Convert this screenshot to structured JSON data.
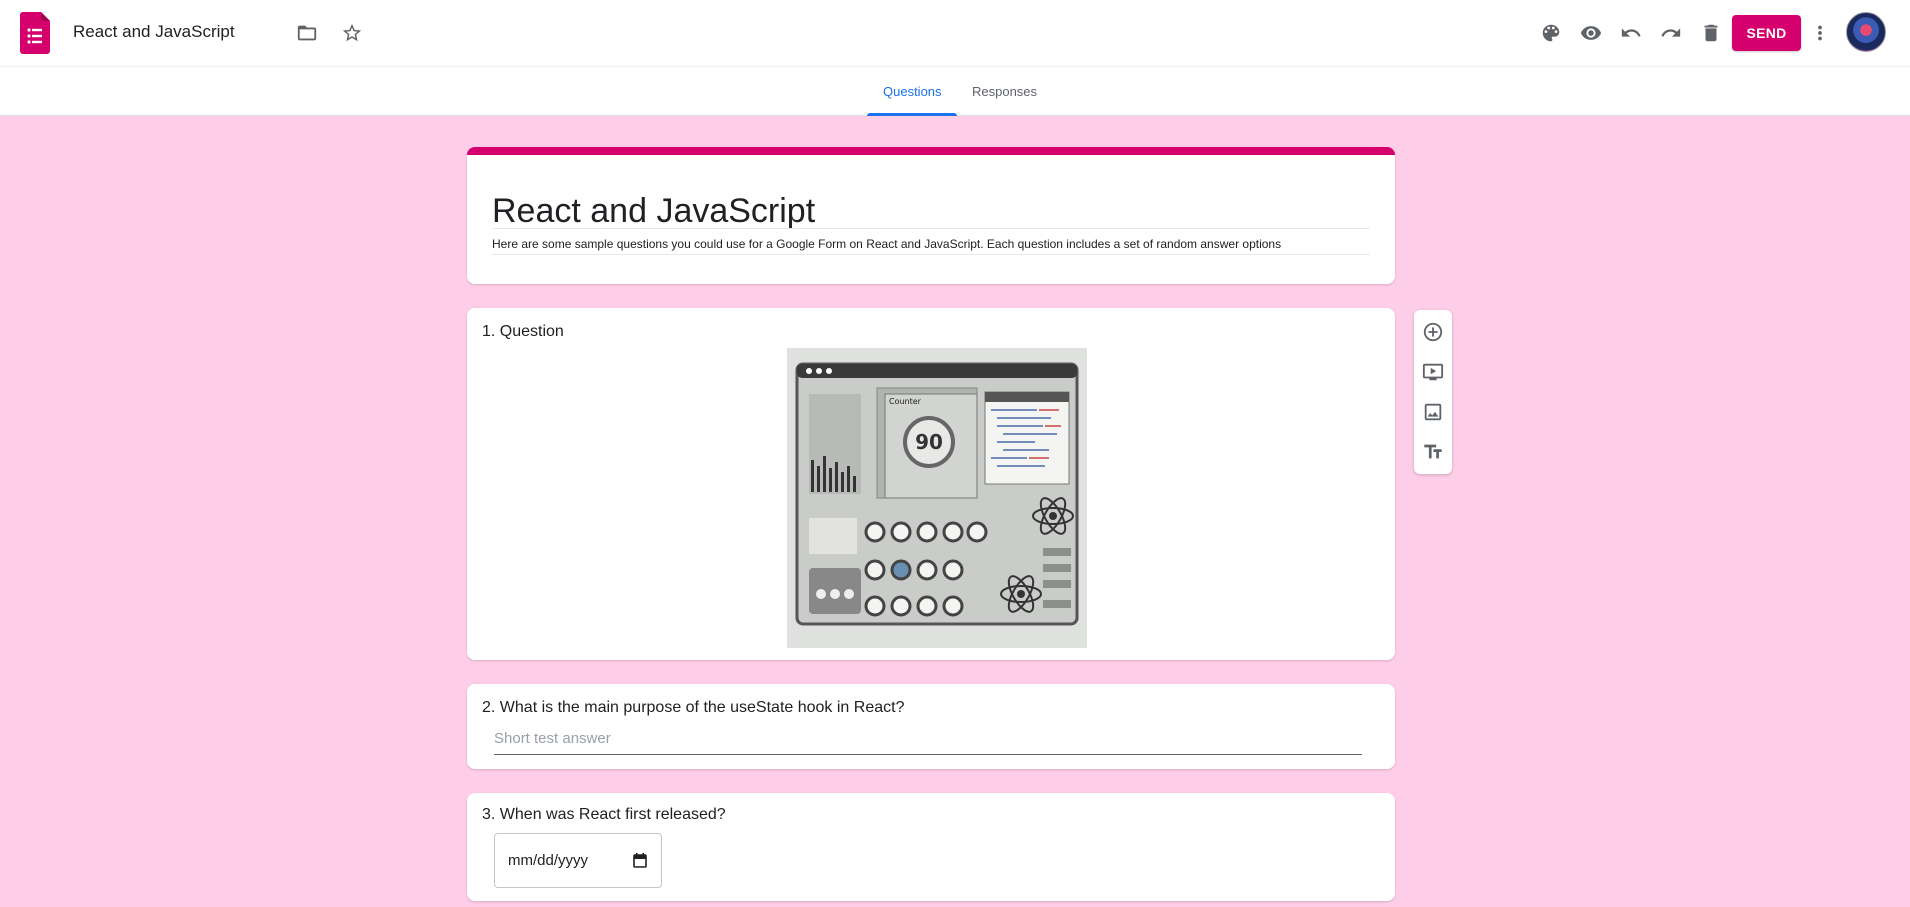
{
  "header": {
    "title": "React and JavaScript",
    "send_label": "SEND"
  },
  "tabs": [
    {
      "label": "Questions",
      "active": true
    },
    {
      "label": "Responses",
      "active": false
    }
  ],
  "form": {
    "title": "React and JavaScript",
    "description": "Here are some sample questions you could use for a Google Form on React and JavaScript. Each question includes a set of random answer options"
  },
  "questions": [
    {
      "title": "1. Question",
      "image": {
        "counter_value": "90",
        "panel_label": "Counter"
      }
    },
    {
      "title": "2. What is the main purpose of the useState hook in React?",
      "placeholder": "Short test answer"
    },
    {
      "title": "3. When was React first released?",
      "date_placeholder": "mm/dd/yyyy"
    }
  ],
  "colors": {
    "accent": "#d5006d",
    "background": "#fecde7",
    "tab_active": "#1a73e8"
  },
  "icons": {
    "toolbar": [
      "palette-icon",
      "eye-icon",
      "undo-icon",
      "redo-icon",
      "trash-icon",
      "more-vert-icon"
    ],
    "side": [
      "add-circle-icon",
      "video-icon",
      "image-icon",
      "text-format-icon"
    ]
  }
}
